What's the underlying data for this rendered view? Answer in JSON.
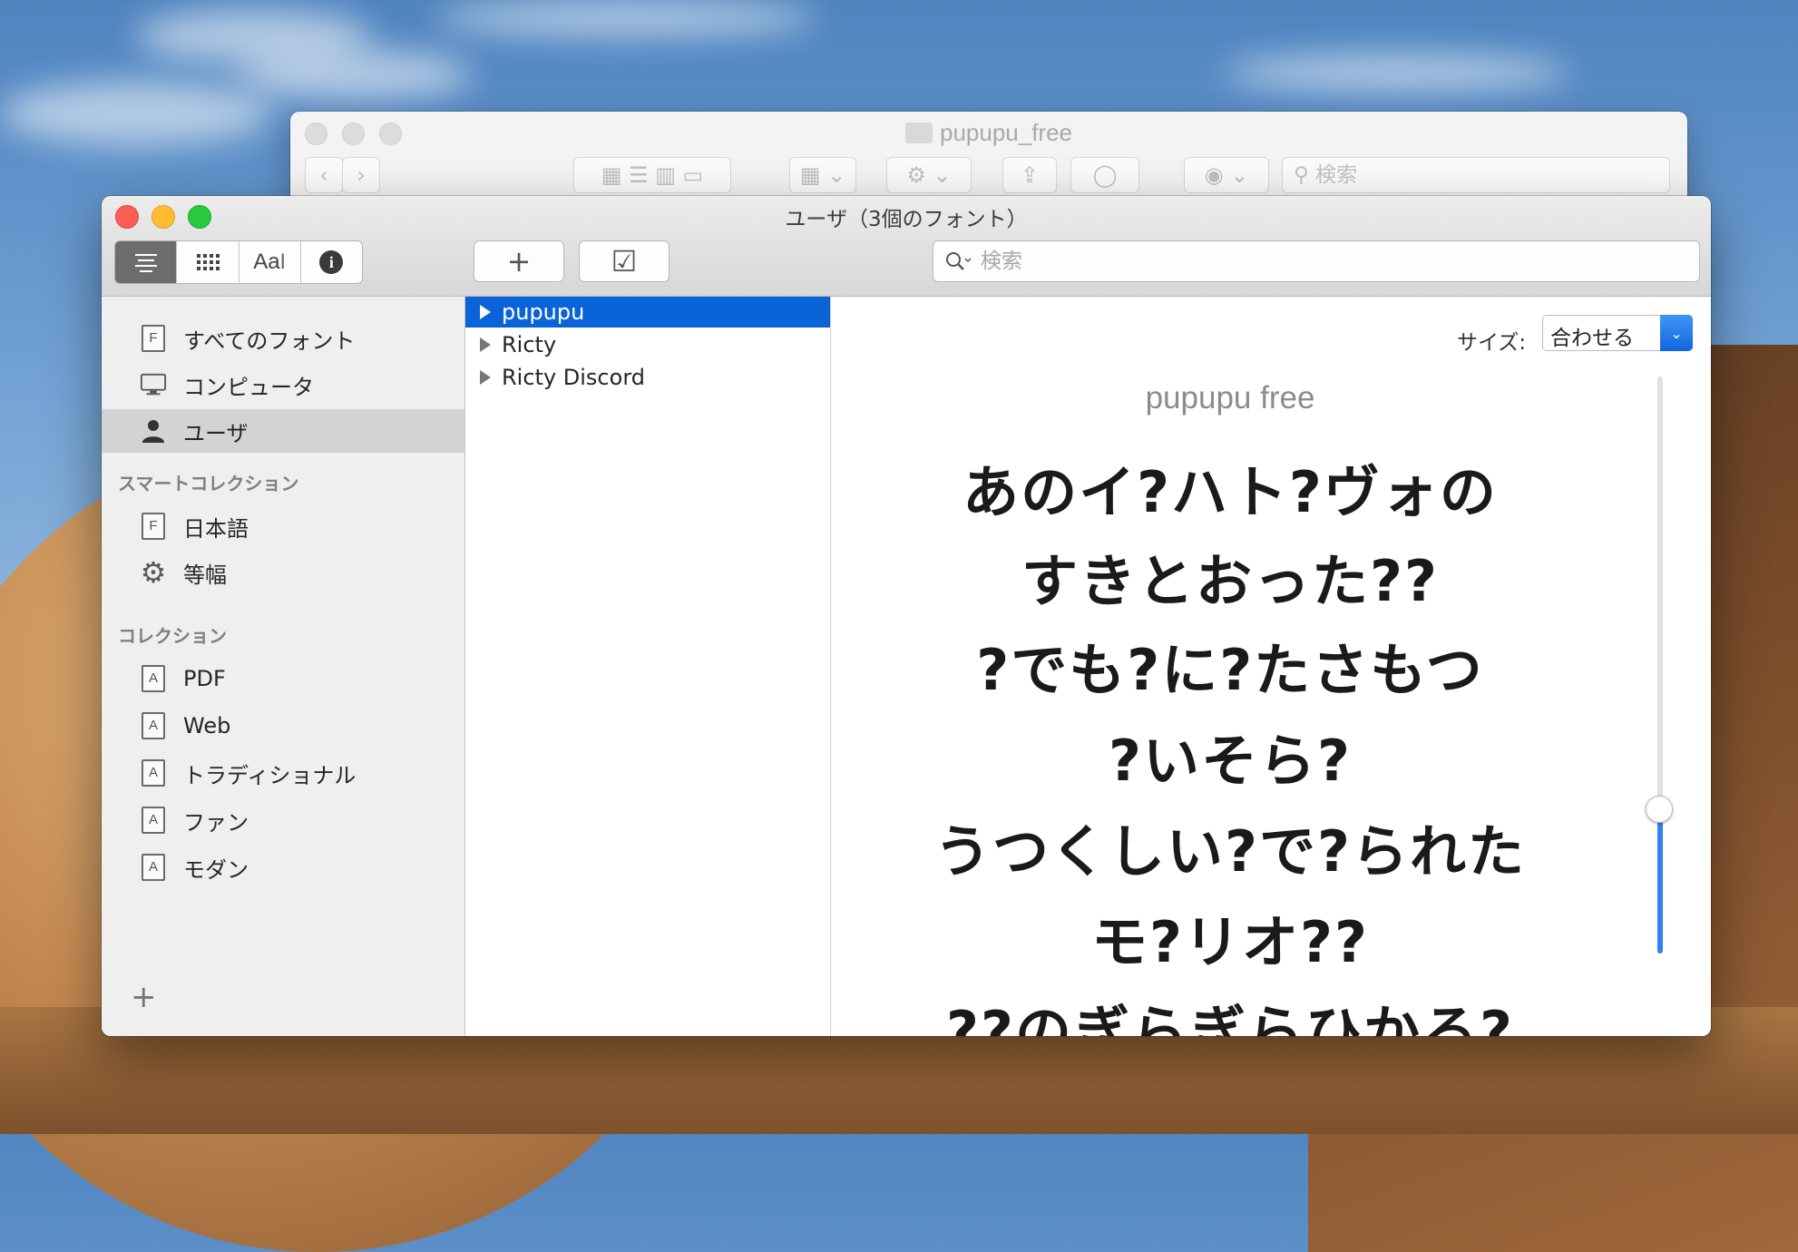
{
  "finder": {
    "title": "pupupu_free",
    "search_placeholder": "検索"
  },
  "window": {
    "title": "ユーザ（3個のフォント）",
    "search_placeholder": "検索"
  },
  "toolbar": {
    "view_text": "Aa",
    "add_label": "+",
    "validate_label": "☑",
    "info_label": "i"
  },
  "sidebar": {
    "library": [
      {
        "label": "すべてのフォント",
        "icon": "font-document-icon",
        "selected": false
      },
      {
        "label": "コンピュータ",
        "icon": "computer-icon",
        "selected": false
      },
      {
        "label": "ユーザ",
        "icon": "user-icon",
        "selected": true
      }
    ],
    "smart_collections_header": "スマートコレクション",
    "smart_collections": [
      {
        "label": "日本語",
        "icon": "font-document-icon"
      },
      {
        "label": "等幅",
        "icon": "gear-icon"
      }
    ],
    "collections_header": "コレクション",
    "collections": [
      {
        "label": "PDF",
        "icon": "collection-icon"
      },
      {
        "label": "Web",
        "icon": "collection-icon"
      },
      {
        "label": "トラディショナル",
        "icon": "collection-icon"
      },
      {
        "label": "ファン",
        "icon": "collection-icon"
      },
      {
        "label": "モダン",
        "icon": "collection-icon"
      }
    ],
    "add_label": "+"
  },
  "fonts": [
    {
      "name": "pupupu",
      "selected": true
    },
    {
      "name": "Ricty",
      "selected": false
    },
    {
      "name": "Ricty Discord",
      "selected": false
    }
  ],
  "preview": {
    "size_label": "サイズ:",
    "size_value": "合わせる",
    "font_name": "pupupu free",
    "lines": [
      "あのイ?ハト?ヴォの",
      "すきとおった??",
      "?でも?に?たさもつ",
      "?いそら?",
      "うつくしい?で?られた",
      "モ?リオ??",
      "??のぎらぎらひかる?"
    ],
    "size_slider_level": 0.17
  },
  "colors": {
    "selection": "#0b63d8",
    "close": "#fd5f57",
    "minimize": "#febc2e",
    "zoom": "#28c840"
  }
}
